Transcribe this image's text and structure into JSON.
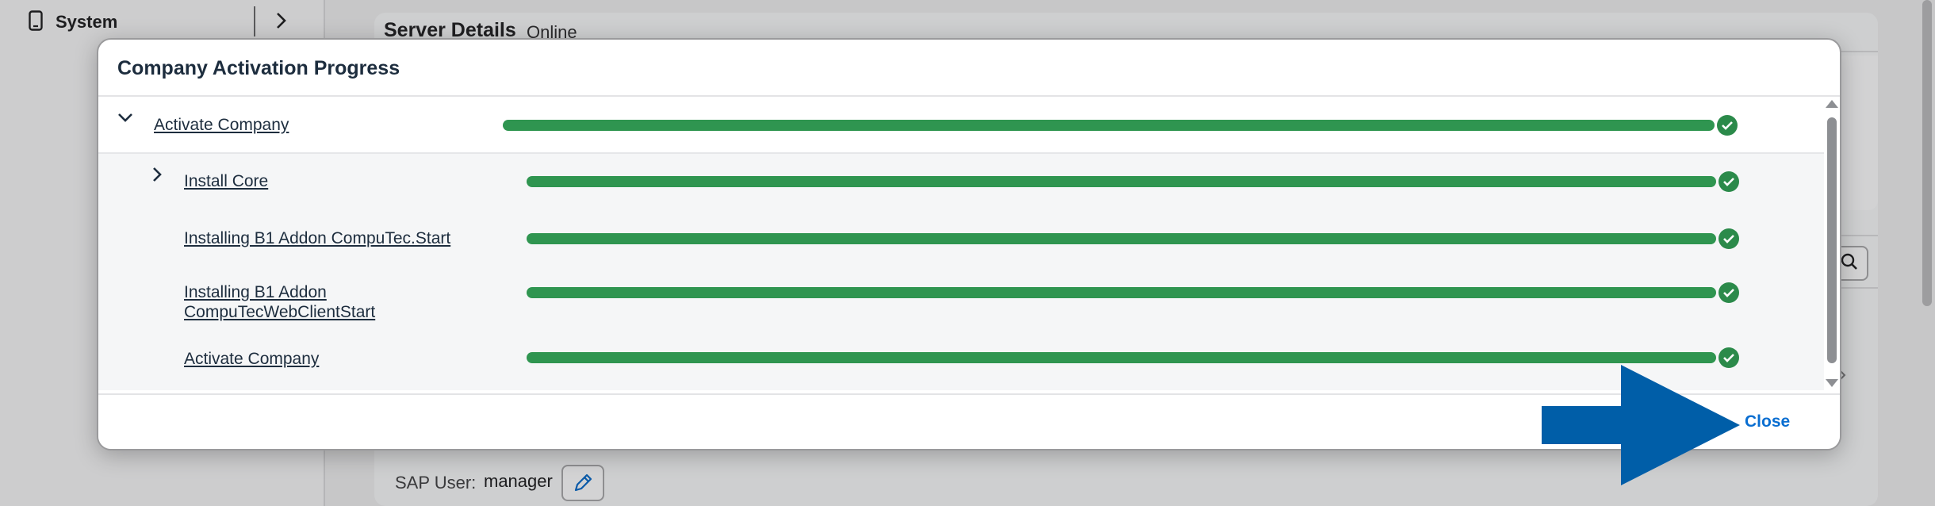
{
  "background": {
    "sidebar": {
      "system_label": "System"
    },
    "card": {
      "title": "Server Details",
      "status": "Online"
    },
    "sap_user": {
      "label": "SAP User:",
      "value": "manager"
    }
  },
  "dialog": {
    "title": "Company Activation Progress",
    "rows": [
      {
        "label": "Activate Company",
        "progress": 1.0,
        "status": "completed",
        "expanded": true,
        "level": 0
      },
      {
        "label": "Install Core",
        "progress": 1.0,
        "status": "completed",
        "expanded": false,
        "level": 1
      },
      {
        "label": "Installing B1 Addon CompuTec.Start",
        "progress": 1.0,
        "status": "completed",
        "level": 1
      },
      {
        "label_line1": "Installing B1 Addon",
        "label_line2": "CompuTecWebClientStart",
        "progress": 1.0,
        "status": "completed",
        "level": 1
      },
      {
        "label": "Activate Company",
        "progress": 1.0,
        "status": "completed",
        "level": 1
      }
    ],
    "footer": {
      "close_label": "Close"
    }
  },
  "colors": {
    "progress_fill": "#2f9550",
    "success_check": "#2b8a4a",
    "link_blue": "#0a6ed1",
    "annotation_arrow": "#005ea8"
  },
  "icons": [
    "phone-icon",
    "chevron-right-icon",
    "chevron-down-icon",
    "check-circle-icon",
    "search-icon",
    "pencil-icon",
    "annotation-arrow"
  ]
}
